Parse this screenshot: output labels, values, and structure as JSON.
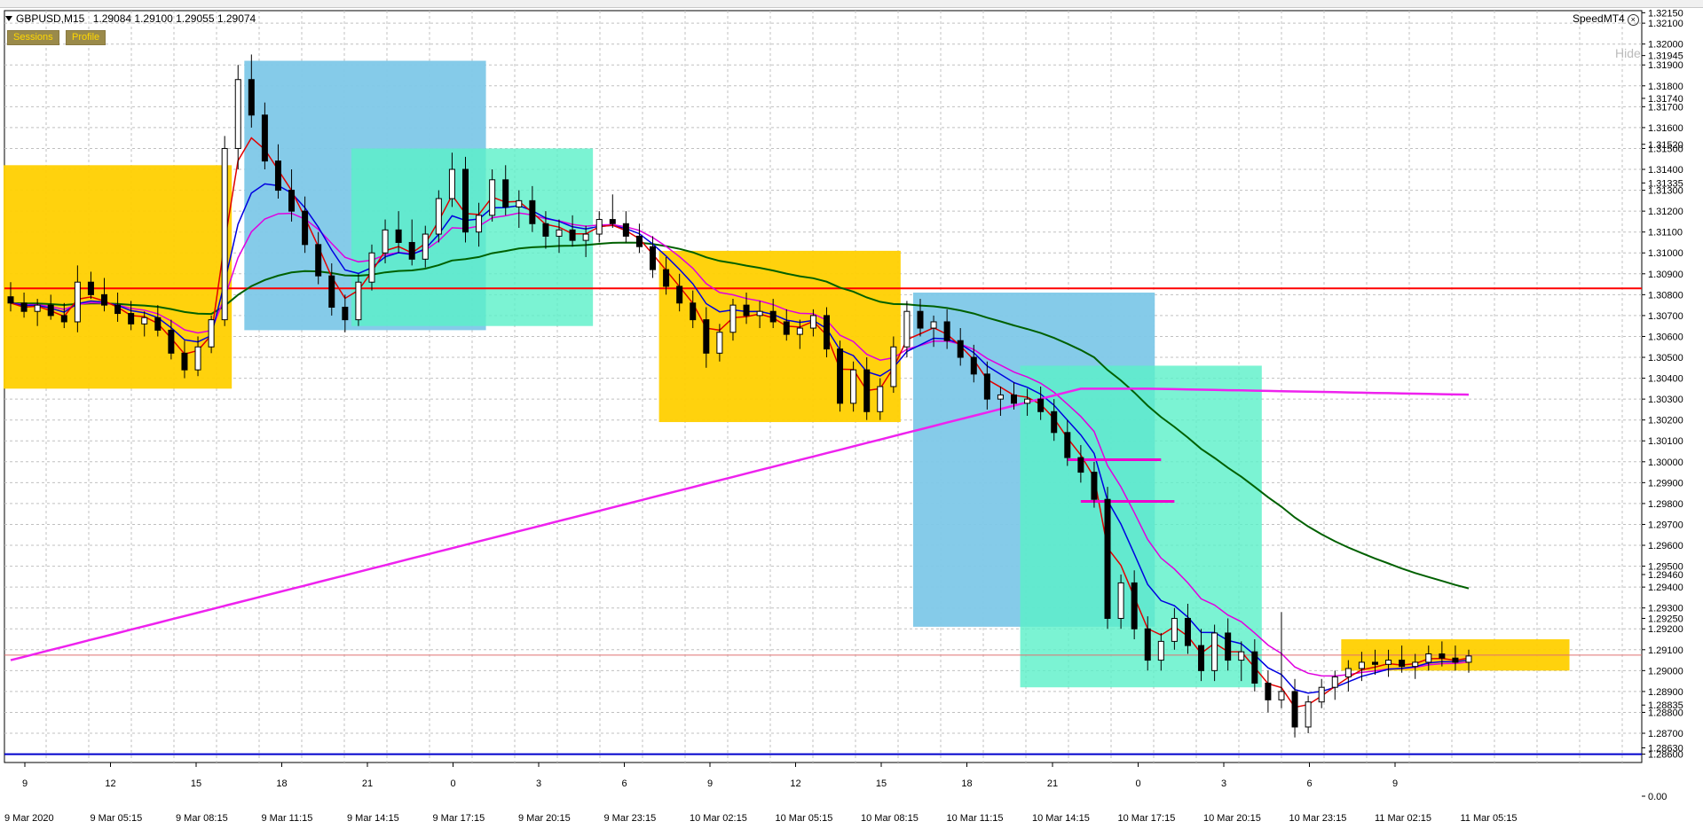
{
  "header": {
    "symbol_info": "GBPUSD,M15",
    "ohlc": "1.29084 1.29100 1.29055 1.29074"
  },
  "buttons": {
    "sessions": "Sessions",
    "profile": "Profile"
  },
  "indicator": {
    "name": "SpeedMT4",
    "close_glyph": "×",
    "hide_label": "Hide"
  },
  "colors": {
    "background": "#ffffff",
    "grid": "#c0c0c0",
    "ma_fast": "#e00000",
    "ma_mid": "#0000e0",
    "ma_slow": "#e000e0",
    "ma_long": "#006000",
    "ma_200": "#ee22ee",
    "session_asia": "#ffd000",
    "session_london": "#7ec8e8",
    "session_ny": "#5af0c8",
    "red_line": "#ff0000",
    "blue_line": "#0000cc"
  },
  "chart_data": {
    "type": "candlestick",
    "symbol": "GBPUSD",
    "timeframe": "M15",
    "ylim": [
      1.2856,
      1.3216
    ],
    "y_ticks": [
      "1.32150",
      "1.32100",
      "1.32000",
      "1.31945",
      "1.31900",
      "1.31800",
      "1.31740",
      "1.31700",
      "1.31600",
      "1.31520",
      "1.31500",
      "1.31400",
      "1.31335",
      "1.31300",
      "1.31200",
      "1.31100",
      "1.31000",
      "1.30900",
      "1.30800",
      "1.30700",
      "1.30600",
      "1.30500",
      "1.30400",
      "1.30300",
      "1.30200",
      "1.30100",
      "1.30000",
      "1.29900",
      "1.29800",
      "1.29700",
      "1.29600",
      "1.29500",
      "1.29460",
      "1.29400",
      "1.29300",
      "1.29250",
      "1.29200",
      "1.29100",
      "1.29000",
      "1.28900",
      "1.28835",
      "1.28800",
      "1.28700",
      "1.28630",
      "1.28600",
      "0.00"
    ],
    "x_hour_ticks": [
      "9",
      "12",
      "15",
      "18",
      "21",
      "0",
      "3",
      "6",
      "9",
      "12",
      "15",
      "18",
      "21",
      "0",
      "3",
      "6",
      "9"
    ],
    "x_date_ticks": [
      "9 Mar 2020",
      "9 Mar 05:15",
      "9 Mar 08:15",
      "9 Mar 11:15",
      "9 Mar 14:15",
      "9 Mar 17:15",
      "9 Mar 20:15",
      "9 Mar 23:15",
      "10 Mar 02:15",
      "10 Mar 05:15",
      "10 Mar 08:15",
      "10 Mar 11:15",
      "10 Mar 14:15",
      "10 Mar 17:15",
      "10 Mar 20:15",
      "10 Mar 23:15",
      "11 Mar 02:15",
      "11 Mar 05:15"
    ],
    "horizontal_lines": [
      {
        "name": "resistance",
        "price": 1.3083,
        "color": "#ff0000"
      },
      {
        "name": "support",
        "price": 1.286,
        "color": "#0000cc"
      },
      {
        "name": "current",
        "price": 1.29074,
        "color": "#e07070"
      }
    ],
    "session_boxes": [
      {
        "kind": "asia",
        "t_start": 0,
        "t_end": 16,
        "high": 1.3142,
        "low": 1.3035
      },
      {
        "kind": "london",
        "t_start": 18,
        "t_end": 35,
        "high": 1.3192,
        "low": 1.3063
      },
      {
        "kind": "ny",
        "t_start": 26,
        "t_end": 43,
        "high": 1.315,
        "low": 1.3065
      },
      {
        "kind": "asia",
        "t_start": 49,
        "t_end": 66,
        "high": 1.3101,
        "low": 1.3019
      },
      {
        "kind": "london",
        "t_start": 68,
        "t_end": 85,
        "high": 1.3081,
        "low": 1.2921
      },
      {
        "kind": "ny",
        "t_start": 76,
        "t_end": 93,
        "high": 1.3046,
        "low": 1.2892
      },
      {
        "kind": "asia",
        "t_start": 100,
        "t_end": 116,
        "high": 1.2915,
        "low": 1.29
      }
    ],
    "level_marks": [
      {
        "price": 1.3001,
        "t_start": 79,
        "t_end": 86
      },
      {
        "price": 1.2981,
        "t_start": 80,
        "t_end": 87
      }
    ],
    "candles": [
      [
        1.3079,
        1.3086,
        1.3072,
        1.3076
      ],
      [
        1.3076,
        1.3081,
        1.3069,
        1.3072
      ],
      [
        1.3072,
        1.3078,
        1.3065,
        1.3075
      ],
      [
        1.3075,
        1.308,
        1.3068,
        1.307
      ],
      [
        1.307,
        1.3076,
        1.3064,
        1.3067
      ],
      [
        1.3067,
        1.3094,
        1.3062,
        1.3086
      ],
      [
        1.3086,
        1.3091,
        1.3078,
        1.308
      ],
      [
        1.308,
        1.3088,
        1.3072,
        1.3075
      ],
      [
        1.3075,
        1.3081,
        1.3067,
        1.3071
      ],
      [
        1.3071,
        1.3077,
        1.3063,
        1.3066
      ],
      [
        1.3066,
        1.3072,
        1.306,
        1.3069
      ],
      [
        1.3069,
        1.3075,
        1.306,
        1.3063
      ],
      [
        1.3063,
        1.3068,
        1.3049,
        1.3052
      ],
      [
        1.3052,
        1.3058,
        1.304,
        1.3044
      ],
      [
        1.3044,
        1.306,
        1.3041,
        1.3055
      ],
      [
        1.3055,
        1.307,
        1.3052,
        1.3068
      ],
      [
        1.3068,
        1.3156,
        1.3065,
        1.315
      ],
      [
        1.315,
        1.319,
        1.314,
        1.3183
      ],
      [
        1.3183,
        1.3195,
        1.316,
        1.3166
      ],
      [
        1.3166,
        1.3172,
        1.314,
        1.3144
      ],
      [
        1.3144,
        1.3152,
        1.3126,
        1.313
      ],
      [
        1.313,
        1.314,
        1.3115,
        1.312
      ],
      [
        1.312,
        1.3127,
        1.31,
        1.3104
      ],
      [
        1.3104,
        1.311,
        1.3085,
        1.3089
      ],
      [
        1.3089,
        1.3095,
        1.307,
        1.3074
      ],
      [
        1.3074,
        1.308,
        1.3062,
        1.3068
      ],
      [
        1.3068,
        1.309,
        1.3065,
        1.3086
      ],
      [
        1.3086,
        1.3104,
        1.3082,
        1.31
      ],
      [
        1.31,
        1.3116,
        1.3095,
        1.3111
      ],
      [
        1.3111,
        1.312,
        1.31,
        1.3105
      ],
      [
        1.3105,
        1.3116,
        1.3094,
        1.3097
      ],
      [
        1.3097,
        1.3113,
        1.3093,
        1.3109
      ],
      [
        1.3109,
        1.313,
        1.3105,
        1.3126
      ],
      [
        1.3126,
        1.3148,
        1.3122,
        1.314
      ],
      [
        1.314,
        1.3146,
        1.3105,
        1.311
      ],
      [
        1.311,
        1.3124,
        1.3103,
        1.3118
      ],
      [
        1.3118,
        1.314,
        1.3115,
        1.3135
      ],
      [
        1.3135,
        1.3142,
        1.3118,
        1.3122
      ],
      [
        1.3122,
        1.313,
        1.3112,
        1.3125
      ],
      [
        1.3125,
        1.3132,
        1.311,
        1.3114
      ],
      [
        1.3114,
        1.312,
        1.3102,
        1.3108
      ],
      [
        1.3108,
        1.3116,
        1.31,
        1.3111
      ],
      [
        1.3111,
        1.3118,
        1.3103,
        1.3106
      ],
      [
        1.3106,
        1.3113,
        1.3098,
        1.3109
      ],
      [
        1.3109,
        1.312,
        1.3105,
        1.3116
      ],
      [
        1.3116,
        1.3128,
        1.3112,
        1.3114
      ],
      [
        1.3114,
        1.312,
        1.3105,
        1.3108
      ],
      [
        1.3108,
        1.3114,
        1.31,
        1.3103
      ],
      [
        1.3103,
        1.3108,
        1.3088,
        1.3092
      ],
      [
        1.3092,
        1.3098,
        1.308,
        1.3084
      ],
      [
        1.3084,
        1.309,
        1.3072,
        1.3076
      ],
      [
        1.3076,
        1.3082,
        1.3064,
        1.3068
      ],
      [
        1.3068,
        1.3074,
        1.3045,
        1.3052
      ],
      [
        1.3052,
        1.3066,
        1.3048,
        1.3062
      ],
      [
        1.3062,
        1.3078,
        1.3058,
        1.3075
      ],
      [
        1.3075,
        1.3081,
        1.3066,
        1.307
      ],
      [
        1.307,
        1.3077,
        1.3064,
        1.3072
      ],
      [
        1.3072,
        1.3078,
        1.3064,
        1.3067
      ],
      [
        1.3067,
        1.3073,
        1.3058,
        1.3061
      ],
      [
        1.3061,
        1.3068,
        1.3054,
        1.3064
      ],
      [
        1.3064,
        1.3073,
        1.306,
        1.307
      ],
      [
        1.307,
        1.3074,
        1.305,
        1.3054
      ],
      [
        1.3054,
        1.3058,
        1.3024,
        1.3028
      ],
      [
        1.3028,
        1.3048,
        1.3024,
        1.3044
      ],
      [
        1.3044,
        1.305,
        1.302,
        1.3024
      ],
      [
        1.3024,
        1.304,
        1.302,
        1.3036
      ],
      [
        1.3036,
        1.306,
        1.3033,
        1.3055
      ],
      [
        1.3055,
        1.3077,
        1.305,
        1.3072
      ],
      [
        1.3072,
        1.3078,
        1.306,
        1.3064
      ],
      [
        1.3064,
        1.307,
        1.3055,
        1.3067
      ],
      [
        1.3067,
        1.3073,
        1.3054,
        1.3058
      ],
      [
        1.3058,
        1.3064,
        1.3046,
        1.305
      ],
      [
        1.305,
        1.3056,
        1.3038,
        1.3042
      ],
      [
        1.3042,
        1.3048,
        1.3025,
        1.303
      ],
      [
        1.303,
        1.3036,
        1.3022,
        1.3032
      ],
      [
        1.3032,
        1.3038,
        1.3025,
        1.3028
      ],
      [
        1.3028,
        1.3035,
        1.3022,
        1.303
      ],
      [
        1.303,
        1.3036,
        1.302,
        1.3024
      ],
      [
        1.3024,
        1.303,
        1.301,
        1.3014
      ],
      [
        1.3014,
        1.302,
        1.2998,
        1.3002
      ],
      [
        1.3002,
        1.3008,
        1.299,
        1.2995
      ],
      [
        1.2995,
        1.3,
        1.2978,
        1.2982
      ],
      [
        1.2982,
        1.2988,
        1.292,
        1.2925
      ],
      [
        1.2925,
        1.2946,
        1.292,
        1.2942
      ],
      [
        1.2942,
        1.2948,
        1.2915,
        1.292
      ],
      [
        1.292,
        1.2926,
        1.29,
        1.2905
      ],
      [
        1.2905,
        1.2918,
        1.29,
        1.2914
      ],
      [
        1.2914,
        1.293,
        1.291,
        1.2925
      ],
      [
        1.2925,
        1.2932,
        1.2908,
        1.2912
      ],
      [
        1.2912,
        1.292,
        1.2895,
        1.29
      ],
      [
        1.29,
        1.2922,
        1.2895,
        1.2918
      ],
      [
        1.2918,
        1.2925,
        1.29,
        1.2905
      ],
      [
        1.2905,
        1.2914,
        1.2895,
        1.2909
      ],
      [
        1.2909,
        1.2915,
        1.289,
        1.2894
      ],
      [
        1.2894,
        1.29,
        1.288,
        1.2886
      ],
      [
        1.2886,
        1.2928,
        1.2882,
        1.289
      ],
      [
        1.289,
        1.2896,
        1.2868,
        1.2873
      ],
      [
        1.2873,
        1.2888,
        1.287,
        1.2885
      ],
      [
        1.2885,
        1.2896,
        1.2882,
        1.2892
      ],
      [
        1.2892,
        1.29,
        1.2886,
        1.2897
      ],
      [
        1.2897,
        1.2905,
        1.289,
        1.2901
      ],
      [
        1.2901,
        1.2909,
        1.2895,
        1.2904
      ],
      [
        1.2904,
        1.291,
        1.2898,
        1.2903
      ],
      [
        1.2903,
        1.291,
        1.2897,
        1.2905
      ],
      [
        1.2905,
        1.2912,
        1.2899,
        1.2902
      ],
      [
        1.2902,
        1.2908,
        1.2896,
        1.2904
      ],
      [
        1.2904,
        1.2912,
        1.29,
        1.2908
      ],
      [
        1.2908,
        1.2914,
        1.2902,
        1.2906
      ],
      [
        1.2906,
        1.2912,
        1.29,
        1.2904
      ],
      [
        1.2904,
        1.291,
        1.2899,
        1.2907
      ]
    ]
  }
}
